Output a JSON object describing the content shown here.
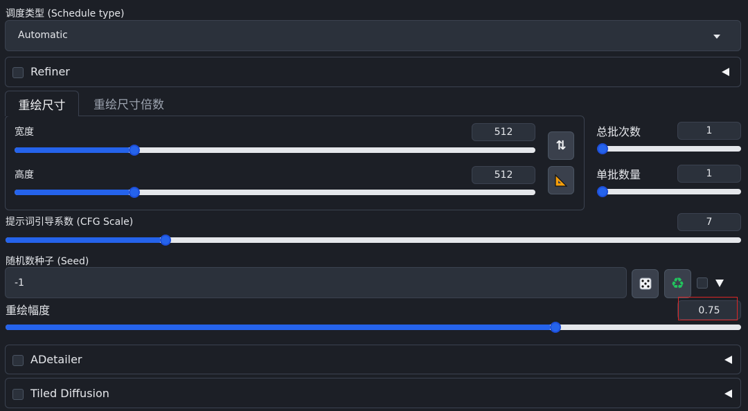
{
  "schedule": {
    "label": "调度类型 (Schedule type)",
    "value": "Automatic",
    "icon": "chevron-down-icon"
  },
  "refiner": {
    "label": "Refiner",
    "checked": false
  },
  "tabs": [
    {
      "label": "重绘尺寸",
      "active": true
    },
    {
      "label": "重绘尺寸倍数",
      "active": false
    }
  ],
  "width": {
    "label": "宽度",
    "value": "512",
    "fraction": 0.22
  },
  "height": {
    "label": "高度",
    "value": "512",
    "fraction": 0.22
  },
  "buttons": {
    "swap_icon": "swap-vertical-icon",
    "swap_glyph": "⇅",
    "ratio_icon": "triangle-ruler-icon",
    "ratio_glyph": "📐"
  },
  "batch_count": {
    "label": "总批次数",
    "value": "1",
    "fraction": 0.0
  },
  "batch_size": {
    "label": "单批数量",
    "value": "1",
    "fraction": 0.0
  },
  "cfg": {
    "label": "提示词引导系数 (CFG Scale)",
    "value": "7",
    "fraction": 0.21
  },
  "seed": {
    "label": "随机数种子 (Seed)",
    "value": "-1",
    "dice_icon": "dice-icon",
    "dice_glyph": "🎲",
    "recycle_icon": "recycle-icon",
    "recycle_glyph": "♻",
    "extra_checked": false
  },
  "denoise": {
    "label": "重绘幅度",
    "value": "0.75",
    "fraction": 0.74,
    "highlight_color": "#dc2626"
  },
  "adetailer": {
    "label": "ADetailer",
    "checked": false
  },
  "tiled": {
    "label": "Tiled Diffusion",
    "checked": false
  },
  "colors": {
    "accent": "#2563eb",
    "background": "#1c1f26",
    "panel": "#2b313b"
  }
}
